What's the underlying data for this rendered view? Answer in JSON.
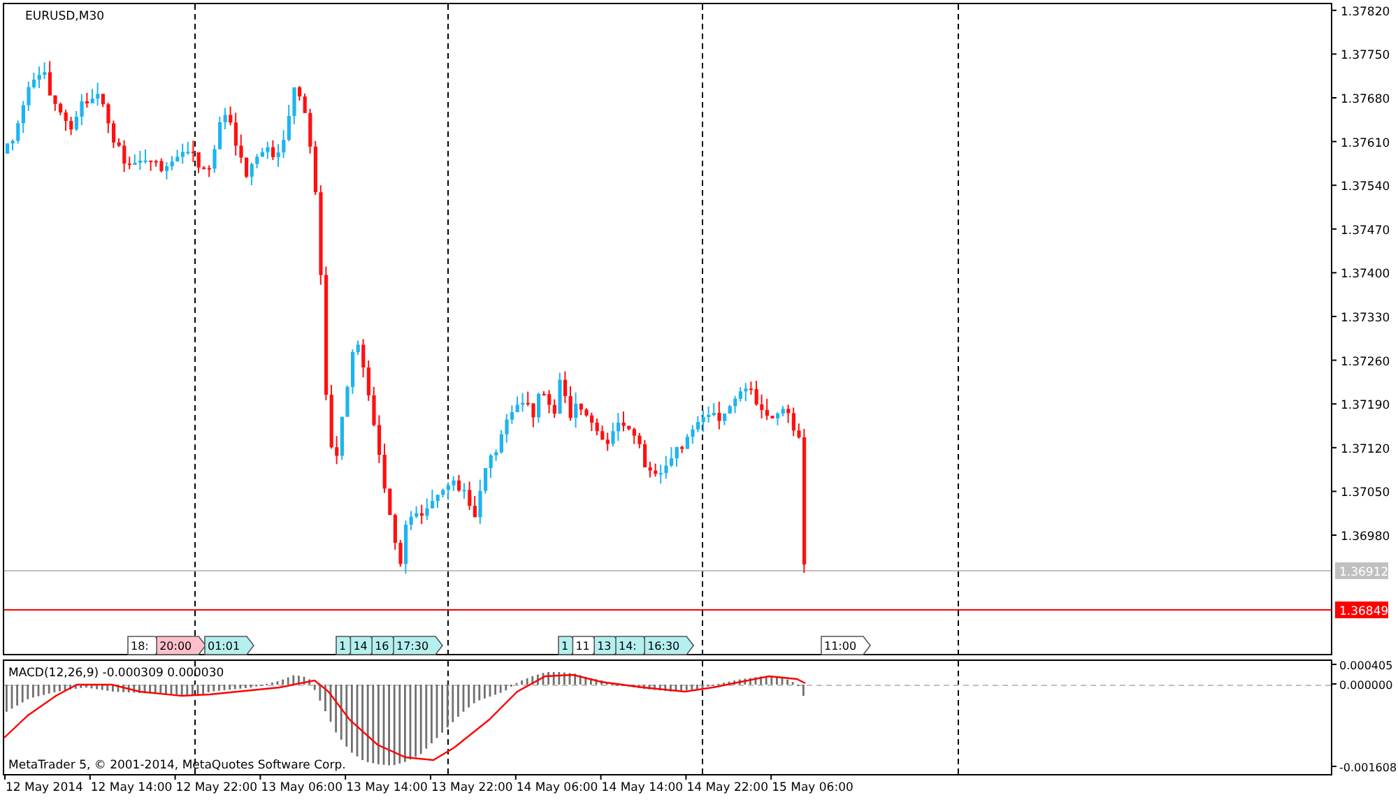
{
  "chart_title": "EURUSD,M30",
  "price_axis": [
    "1.37820",
    "1.37750",
    "1.37680",
    "1.37610",
    "1.37540",
    "1.37470",
    "1.37400",
    "1.37330",
    "1.37260",
    "1.37190",
    "1.37120",
    "1.37050",
    "1.36980"
  ],
  "price_lines": [
    {
      "kind": "bid",
      "label": "1.36912"
    },
    {
      "kind": "ask",
      "label": "1.36849"
    }
  ],
  "events": [
    {
      "label": "18:",
      "color": "#ffffff"
    },
    {
      "label": "20:00",
      "color": "#ffc0cb"
    },
    {
      "label": "01:01",
      "color": "#b4f0f0"
    },
    {
      "label": "1",
      "color": "#b4f0f0"
    },
    {
      "label": "14",
      "color": "#b4f0f0"
    },
    {
      "label": "16",
      "color": "#b4f0f0"
    },
    {
      "label": "17:30",
      "color": "#b4f0f0"
    },
    {
      "label": "1",
      "color": "#b4f0f0"
    },
    {
      "label": "11",
      "color": "#ffffff"
    },
    {
      "label": "13",
      "color": "#b4f0f0"
    },
    {
      "label": "14:",
      "color": "#b4f0f0"
    },
    {
      "label": "16:30",
      "color": "#b4f0f0"
    },
    {
      "label": "11:00",
      "color": "#ffffff"
    }
  ],
  "indicator": {
    "label": "MACD(12,26,9) -0.000309 0.000030",
    "axis": [
      "0.000405",
      "0.000000",
      "-0.001608"
    ]
  },
  "copyright": "MetaTrader 5, © 2001-2014, MetaQuotes Software Corp.",
  "time_axis": [
    "12 May 2014",
    "12 May 14:00",
    "12 May 22:00",
    "13 May 06:00",
    "13 May 14:00",
    "13 May 22:00",
    "14 May 06:00",
    "14 May 14:00",
    "14 May 22:00",
    "15 May 06:00"
  ]
}
